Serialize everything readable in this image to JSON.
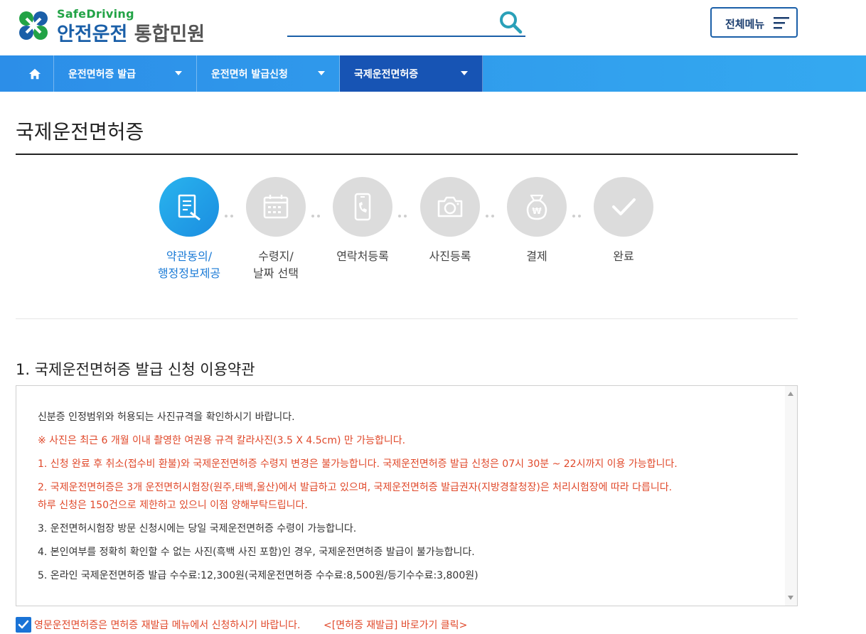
{
  "header": {
    "logo_en": "SafeDriving",
    "logo_main": "안전운전",
    "logo_sub": "통합민원",
    "search_value": "",
    "menu_label": "전체메뉴"
  },
  "nav": {
    "items": [
      {
        "label": "운전면허증 발급"
      },
      {
        "label": "운전면허 발급신청"
      },
      {
        "label": "국제운전면허증"
      }
    ],
    "active_index": 2
  },
  "page": {
    "title": "국제운전면허증"
  },
  "steps": [
    {
      "line1": "약관동의/",
      "line2": "행정정보제공",
      "icon": "document-pen-icon",
      "active": true
    },
    {
      "line1": "수령지/",
      "line2": "날짜 선택",
      "icon": "calendar-icon",
      "active": false
    },
    {
      "line1": "연락처등록",
      "line2": "",
      "icon": "phone-icon",
      "active": false
    },
    {
      "line1": "사진등록",
      "line2": "",
      "icon": "camera-icon",
      "active": false
    },
    {
      "line1": "결제",
      "line2": "",
      "icon": "won-bag-icon",
      "active": false
    },
    {
      "line1": "완료",
      "line2": "",
      "icon": "check-icon",
      "active": false
    }
  ],
  "section": {
    "title": "1. 국제운전면허증 발급 신청 이용약관"
  },
  "terms": {
    "lines": [
      "신분증 인정범위와 허용되는 사진규격을 확인하시기 바랍니다.",
      "※ 사진은 최근 6 개월 이내 촬영한 여권용 규격 칼라사진(3.5 X 4.5cm) 만 가능합니다.",
      "1. 신청 완료 후 취소(접수비 환불)와 국제운전면허증 수령지 변경은 불가능합니다. 국제운전면허증 발급 신청은 07시 30분 ~ 22시까지 이용 가능합니다.",
      "2. 국제운전면허증은 3개 운전면허시험장(원주,태백,울산)에서 발급하고 있으며, 국제운전면허증 발급권자(지방경찰청장)은 처리시험장에 따라 다릅니다.",
      "하루 신청은 150건으로 제한하고 있으니 이점 양해부탁드립니다.",
      "3. 운전면허시험장 방문 신청시에는 당일 국제운전면허증 수령이 가능합니다.",
      "4. 본인여부를 정확히 확인할 수 없는 사진(흑백 사진 포함)인 경우, 국제운전면허증 발급이 불가능합니다.",
      "5. 온라인 국제운전면허증 발급 수수료:12,300원(국제운전면허증 수수료:8,500원/등기수수료:3,800원)"
    ]
  },
  "notice": {
    "text": "영문운전면허증은 면허증 재발급 메뉴에서 신청하시기 바랍니다.",
    "link": "<[면허증 재발급] 바로가기 클릭>",
    "checked": true
  },
  "colors": {
    "brand_blue": "#1a5fa8",
    "nav_start": "#2c8ee8",
    "nav_active": "#1754b4",
    "warning_red": "#e0482a",
    "step_active": "#1b8de0"
  }
}
